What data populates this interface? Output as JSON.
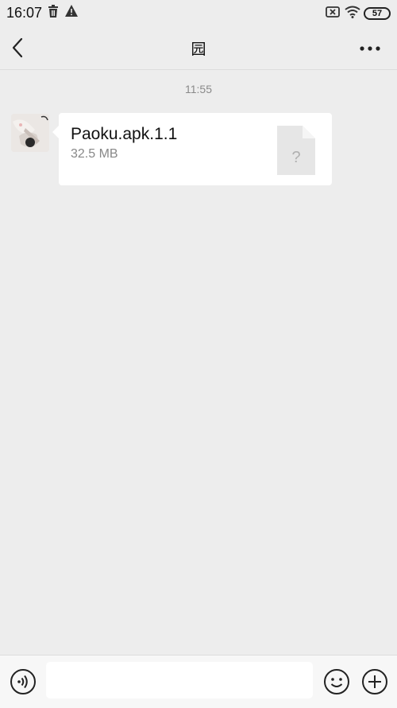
{
  "status_bar": {
    "time": "16:07",
    "battery": "57",
    "icons": [
      "trash-icon",
      "warning-icon",
      "sim-off-icon",
      "wifi-icon",
      "battery-icon"
    ]
  },
  "nav": {
    "title": "园",
    "back_icon": "chevron-left-icon",
    "more_icon": "more-dots-icon"
  },
  "chat": {
    "timestamp": "11:55",
    "message": {
      "file_name": "Paoku.apk.1.1",
      "file_size": "32.5 MB",
      "file_icon": "unknown-file-icon",
      "file_icon_mark": "?"
    }
  },
  "input_bar": {
    "text_value": "",
    "icons": [
      "voice-icon",
      "emoji-icon",
      "plus-icon"
    ]
  },
  "colors": {
    "background": "#ededed",
    "bubble": "#ffffff",
    "secondary_text": "#888888"
  }
}
